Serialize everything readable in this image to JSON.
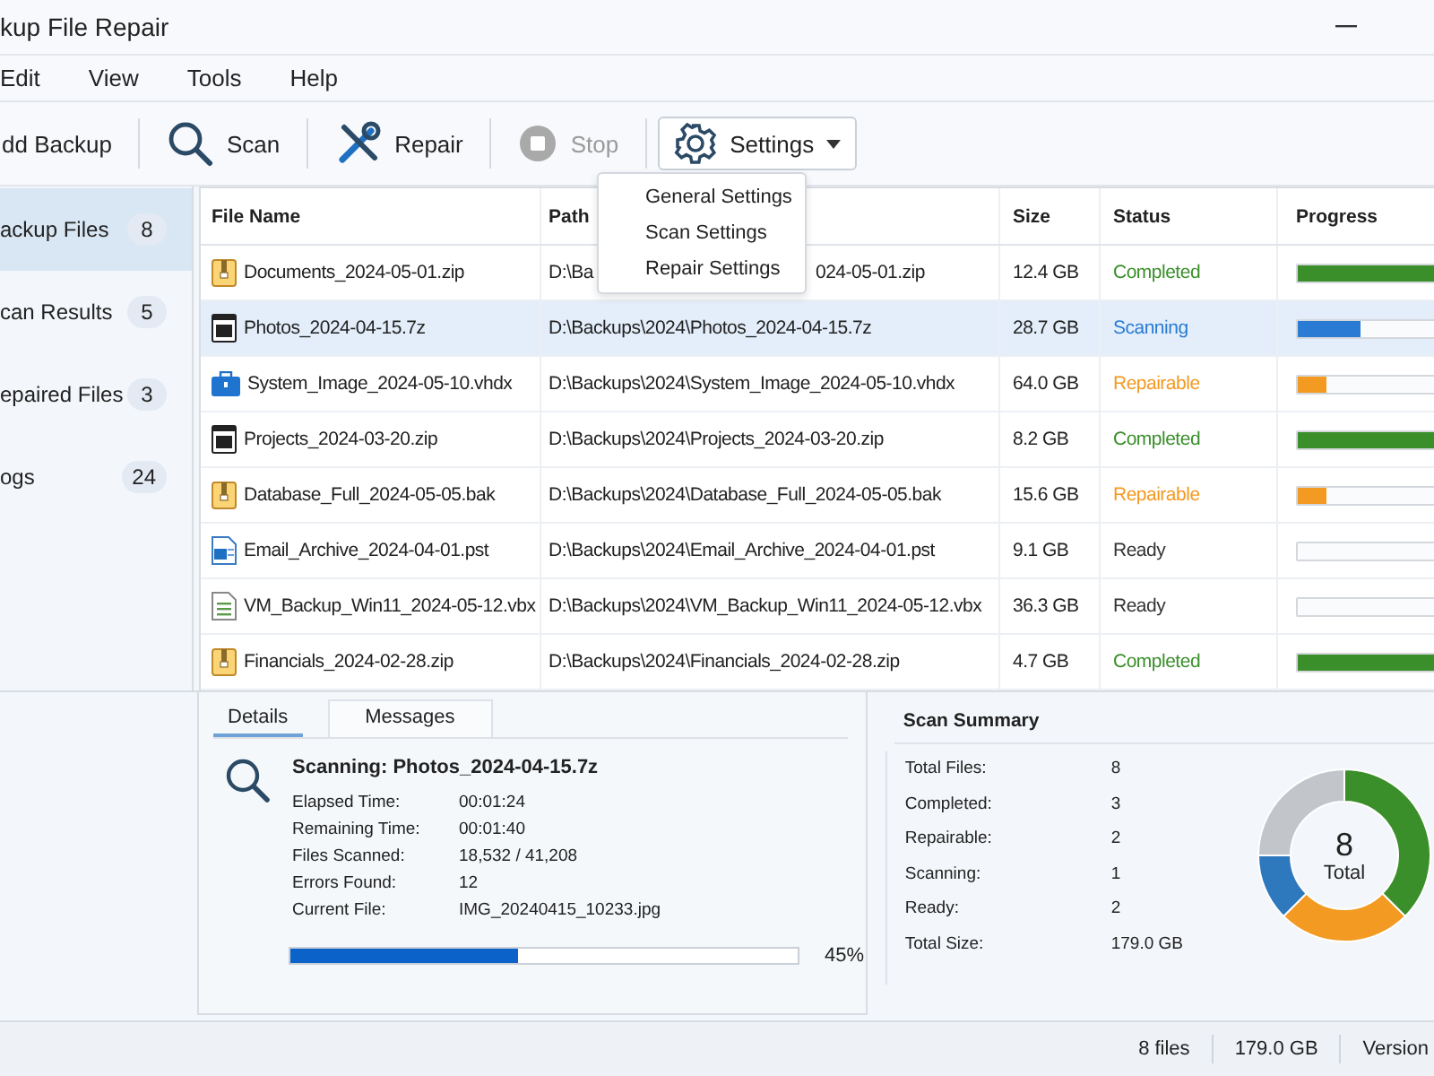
{
  "window": {
    "title": "kup File Repair"
  },
  "menu": [
    "Edit",
    "View",
    "Tools",
    "Help"
  ],
  "toolbar": [
    {
      "kind": "add",
      "label": "dd Backup",
      "disabled": false,
      "expanded": false
    },
    {
      "kind": "scan",
      "label": "Scan",
      "disabled": false,
      "expanded": false
    },
    {
      "kind": "repair",
      "label": "Repair",
      "disabled": false,
      "expanded": false
    },
    {
      "kind": "stop",
      "label": "Stop",
      "disabled": true,
      "expanded": false
    },
    {
      "kind": "settings",
      "label": "Settings",
      "disabled": false,
      "expanded": true
    }
  ],
  "settings_menu": [
    "General Settings",
    "Scan Settings",
    "Repair Settings"
  ],
  "sidebar": {
    "items": [
      {
        "label": "ackup Files",
        "count": "8",
        "selected": true
      },
      {
        "label": "can Results",
        "count": "5",
        "selected": false
      },
      {
        "label": "epaired Files",
        "count": "3",
        "selected": false
      },
      {
        "label": "ogs",
        "count": "24",
        "selected": false
      }
    ]
  },
  "table": {
    "columns": [
      "File Name",
      "Path",
      "Size",
      "Status",
      "Progress"
    ],
    "rows": [
      {
        "kind": "zip",
        "name": "Documents_2024-05-01.zip",
        "path": "D:\\Ba",
        "path_end": "024-05-01.zip",
        "size": "12.4 GB",
        "status": "Completed",
        "color": "#3a8f2a",
        "level": 1.0,
        "selected": false
      },
      {
        "kind": "sevenzip",
        "name": "Photos_2024-04-15.7z",
        "path": "D:\\Backups\\2024\\Photos_2024-04-15.7z",
        "size": "28.7 GB",
        "status": "Scanning",
        "color": "#2a7bd3",
        "level": 0.45,
        "selected": true
      },
      {
        "kind": "vhdx",
        "name": "System_Image_2024-05-10.vhdx",
        "path": "D:\\Backups\\2024\\System_Image_2024-05-10.vhdx",
        "size": "64.0 GB",
        "status": "Repairable",
        "color": "#f39a22",
        "level": 0.2,
        "selected": false
      },
      {
        "kind": "sevenzip",
        "name": "Projects_2024-03-20.zip",
        "path": "D:\\Backups\\2024\\Projects_2024-03-20.zip",
        "size": "8.2 GB",
        "status": "Completed",
        "color": "#3a8f2a",
        "level": 1.0,
        "selected": false
      },
      {
        "kind": "zip",
        "name": "Database_Full_2024-05-05.bak",
        "path": "D:\\Backups\\2024\\Database_Full_2024-05-05.bak",
        "size": "15.6 GB",
        "status": "Repairable",
        "color": "#f39a22",
        "level": 0.2,
        "selected": false
      },
      {
        "kind": "pst",
        "name": "Email_Archive_2024-04-01.pst",
        "path": "D:\\Backups\\2024\\Email_Archive_2024-04-01.pst",
        "size": "9.1 GB",
        "status": "Ready",
        "color": "#333333",
        "level": 0,
        "selected": false
      },
      {
        "kind": "vbx",
        "name": "VM_Backup_Win11_2024-05-12.vbx",
        "path": "D:\\Backups\\2024\\VM_Backup_Win11_2024-05-12.vbx",
        "size": "36.3 GB",
        "status": "Ready",
        "color": "#333333",
        "level": 0,
        "selected": false
      },
      {
        "kind": "zip",
        "name": "Financials_2024-02-28.zip",
        "path": "D:\\Backups\\2024\\Financials_2024-02-28.zip",
        "size": "4.7 GB",
        "status": "Completed",
        "color": "#3a8f2a",
        "level": 1.0,
        "selected": false
      }
    ]
  },
  "details": {
    "tabs": [
      {
        "label": "Details",
        "selected": true
      },
      {
        "label": "Messages",
        "selected": false
      }
    ],
    "heading": "Scanning: Photos_2024-04-15.7z",
    "fields": [
      {
        "label": "Elapsed Time:",
        "value": "00:01:24"
      },
      {
        "label": "Remaining Time:",
        "value": "00:01:40"
      },
      {
        "label": "Files Scanned:",
        "value": "18,532 / 41,208"
      },
      {
        "label": "Errors Found:",
        "value": "12"
      },
      {
        "label": "Current File:",
        "value": "IMG_20240415_10233.jpg"
      }
    ],
    "progress": {
      "level": 0.45,
      "reading": "45%"
    }
  },
  "summary": {
    "title": "Scan Summary",
    "fields": [
      {
        "label": "Total Files:",
        "value": "8"
      },
      {
        "label": "Completed:",
        "value": "3"
      },
      {
        "label": "Repairable:",
        "value": "2"
      },
      {
        "label": "Scanning:",
        "value": "1"
      },
      {
        "label": "Ready:",
        "value": "2"
      },
      {
        "label": "Total Size:",
        "value": "179.0 GB"
      }
    ],
    "center_value": "8",
    "center_label": "Total",
    "chart_data": {
      "type": "donut",
      "values": [
        37.5,
        25,
        12.5,
        25
      ],
      "colors": [
        "#3b8f2a",
        "#f39a22",
        "#2e78bd",
        "#c2c6cb"
      ]
    }
  },
  "status_bar": [
    "8 files",
    "179.0 GB",
    "Version"
  ]
}
